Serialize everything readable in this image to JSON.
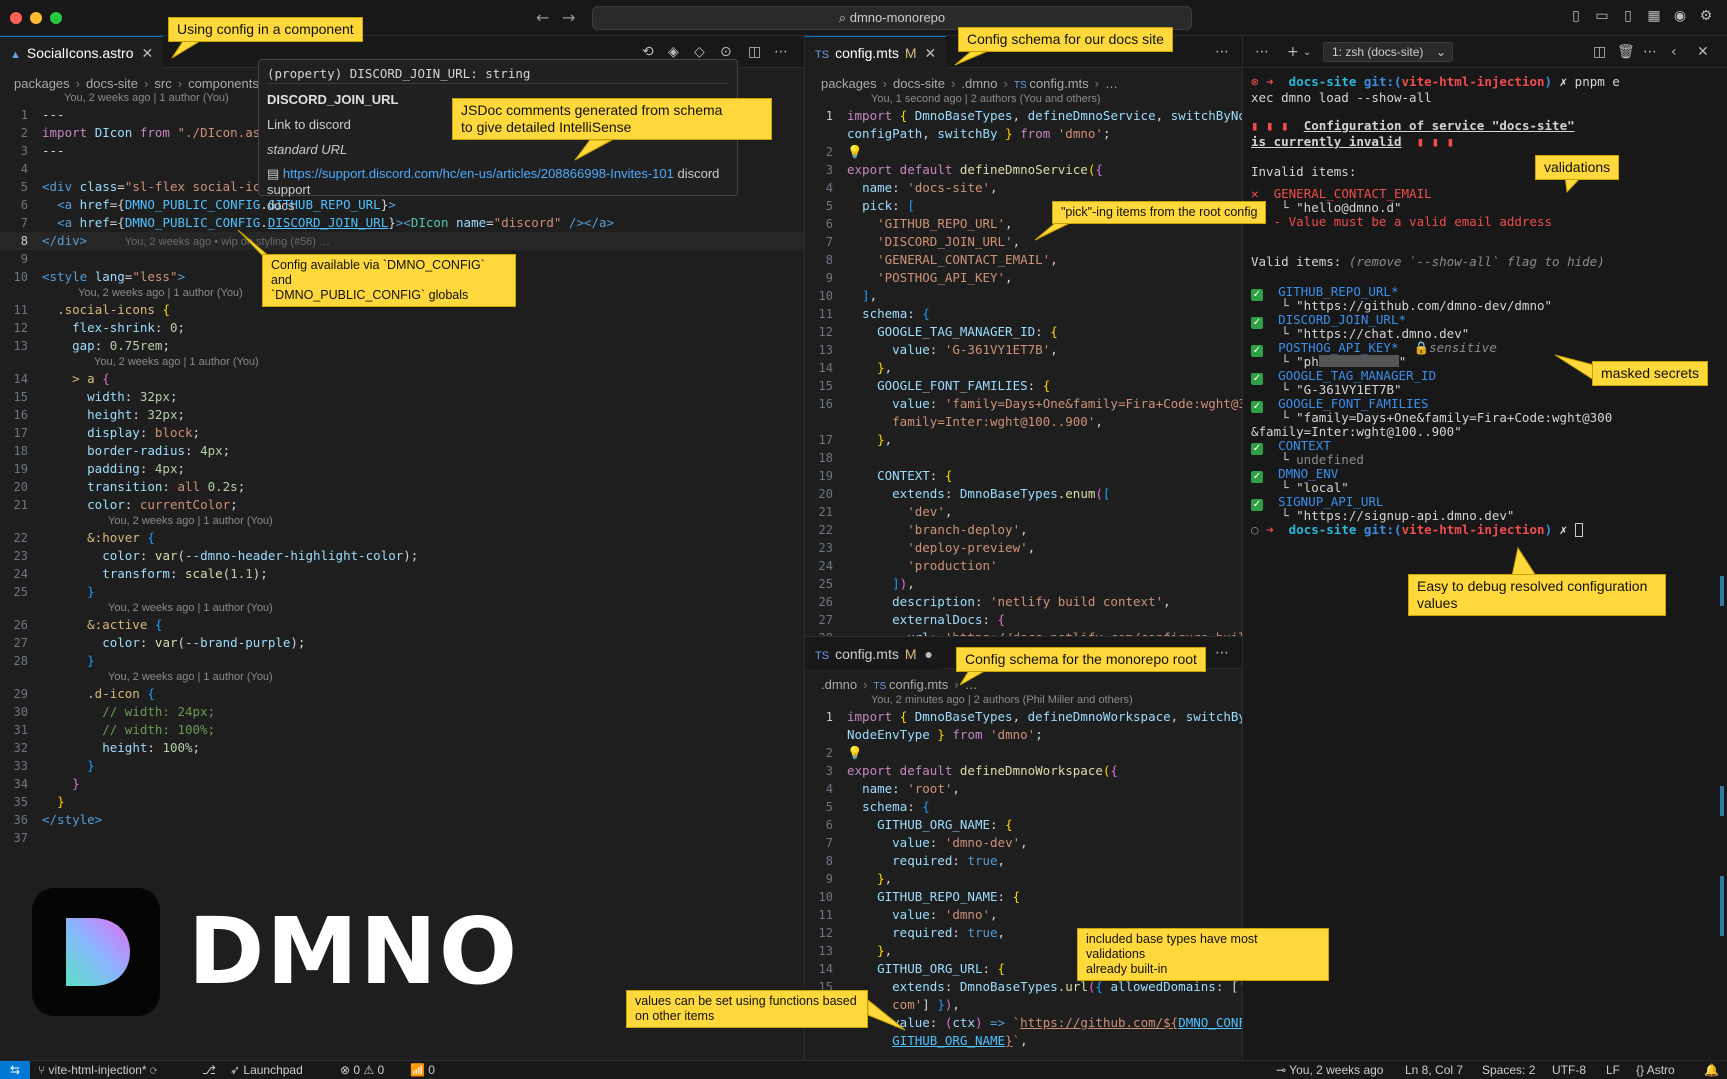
{
  "window": {
    "command_center": "dmno-monorepo"
  },
  "left_editor": {
    "tab_label": "SocialIcons.astro",
    "breadcrumb": [
      "packages",
      "docs-site",
      "src",
      "components"
    ],
    "blame_top": "You, 2 weeks ago | 1 author (You)",
    "lines": {
      "l8_blame": "You, 2 weeks ago • wip on styling (#56) …",
      "blame_style": "You, 2 weeks ago | 1 author (You)"
    },
    "hover": {
      "signature": "(property) DISCORD_JOIN_URL: string",
      "name": "DISCORD_JOIN_URL",
      "description": "Link to discord",
      "type_desc": "standard URL",
      "link_url": "https://support.discord.com/hc/en-us/articles/208866998-Invites-101",
      "link_after": "discord support",
      "link_wrap": "docs"
    }
  },
  "right_top_editor": {
    "tab_label": "config.mts",
    "tab_state": "M",
    "breadcrumb": [
      "packages",
      "docs-site",
      ".dmno",
      "config.mts",
      "…"
    ],
    "blame_top": "You, 1 second ago | 2 authors (You and others)"
  },
  "right_bottom_editor": {
    "tab_label": "config.mts",
    "tab_state": "M",
    "breadcrumb": [
      ".dmno",
      "config.mts",
      "…"
    ],
    "blame_top": "You, 2 minutes ago | 2 authors (Phil Miller and others)"
  },
  "terminal": {
    "selector": "1: zsh (docs-site)",
    "prompt_dir": "docs-site",
    "prompt_branch_label": "git:(",
    "prompt_branch": "vite-html-injection",
    "cmd1": "pnpm e",
    "cmd2": "xec dmno load --show-all",
    "invalid_header_1": "Configuration of service \"docs-site\"",
    "invalid_header_2": "is currently invalid",
    "invalid_items_label": "Invalid items:",
    "invalid_item": "GENERAL_CONTACT_EMAIL",
    "invalid_value": "\"hello@dmno.d\"",
    "invalid_reason": "- Value must be a valid email address",
    "valid_items_label": "Valid items:",
    "valid_items_hint": "(remove `--show-all` flag to hide)",
    "valid_items": [
      {
        "key": "GITHUB_REPO_URL*",
        "value": "\"https://github.com/dmno-dev/dmno\""
      },
      {
        "key": "DISCORD_JOIN_URL*",
        "value": "\"https://chat.dmno.dev\""
      },
      {
        "key": "POSTHOG_API_KEY*",
        "value": "\"ph",
        "sensitive": "sensitive"
      },
      {
        "key": "GOOGLE_TAG_MANAGER_ID",
        "value": "\"G-361VY1ET7B\""
      },
      {
        "key": "GOOGLE_FONT_FAMILIES",
        "value": "\"family=Days+One&family=Fira+Code:wght@300",
        "value2": "&family=Inter:wght@100..900\""
      },
      {
        "key": "CONTEXT",
        "value": "undefined"
      },
      {
        "key": "DMNO_ENV",
        "value": "\"local\""
      },
      {
        "key": "SIGNUP_API_URL",
        "value": "\"https://signup-api.dmno.dev\""
      }
    ]
  },
  "annotations": {
    "using_config": "Using config in a component",
    "jsdoc_1": "JSDoc comments generated from schema",
    "jsdoc_2": "to give detailed IntelliSense",
    "globals_1": "Config available via `DMNO_CONFIG` and",
    "globals_2": "`DMNO_PUBLIC_CONFIG` globals",
    "docs_schema": "Config schema for our docs site",
    "picking": "\"pick\"-ing items from the root config",
    "validations": "validations",
    "masked": "masked secrets",
    "debug_1": "Easy to debug resolved configuration",
    "debug_2": "values",
    "monorepo_schema": "Config schema for the monorepo root",
    "base_types_1": "included base types have most validations",
    "base_types_2": "already built-in",
    "functions_1": "values can be set using functions based",
    "functions_2": "on other items"
  },
  "logo": {
    "wordmark": "DMNO"
  },
  "statusbar": {
    "branch": "vite-html-injection*",
    "launchpad": "Launchpad",
    "problems": "0",
    "warnings": "0",
    "ports": "0",
    "blame": "You, 2 weeks ago",
    "position": "Ln 8, Col 7",
    "spaces": "Spaces: 2",
    "encoding": "UTF-8",
    "eol": "LF",
    "language": "Astro"
  },
  "colors": {
    "accent": "#0078d4",
    "annotation": "#ffd93b",
    "background": "#1e1e1e"
  }
}
